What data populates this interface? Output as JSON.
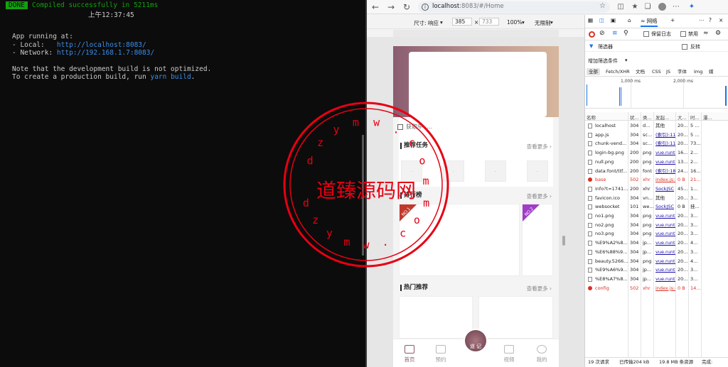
{
  "terminal": {
    "done_badge": "DONE",
    "compiled": "Compiled successfully in 5211ms",
    "time": "上午12:37:45",
    "running": "App running at:",
    "local_label": "- Local:   ",
    "local_url": "http://localhost:8083/",
    "network_label": "- Network: ",
    "network_url": "http://192.168.1.7:8083/",
    "note": "Note that the development build is not optimized.",
    "prod_prefix": "To create a production build, run ",
    "prod_cmd": "yarn build",
    "prod_suffix": "."
  },
  "browser": {
    "url_host": "localhost",
    "url_rest": ":8083/#/Home",
    "back_icon": "arrow-left-icon",
    "forward_icon": "arrow-right-icon",
    "reload_icon": "reload-icon"
  },
  "device_toolbar": {
    "dimensions_label": "尺寸: 响应",
    "width": "385",
    "height": "733",
    "zoom": "100%",
    "throttle": "无限制"
  },
  "page": {
    "notice": "获取中.....",
    "section_tasks": "推荐任务",
    "more": "查看更多",
    "task_items": [
      ".",
      ".",
      ".",
      "."
    ],
    "section_rank": "排行榜",
    "rank_badges": [
      "NO.1",
      "NO.2"
    ],
    "section_hot": "热门推荐",
    "tabs": [
      "首页",
      "预约",
      "",
      "视频",
      "我的"
    ],
    "center_tab": "道 记"
  },
  "devtools": {
    "network_tab": "网络",
    "preserve_log": "保留日志",
    "disable_cache": "禁用",
    "filter": "筛选器",
    "invert": "反转",
    "more_filters": "增加筛选条件",
    "filter_types": [
      "全部",
      "Fetch/XHR",
      "文档",
      "CSS",
      "JS",
      "字体",
      "Img",
      "媒"
    ],
    "timeline_labels": [
      "1,000 ms",
      "2,000 ms"
    ],
    "columns": [
      "名称",
      "状...",
      "类...",
      "发起...",
      "大...",
      "时...",
      "瀑..."
    ],
    "rows": [
      {
        "name": "localhost",
        "status": "304",
        "type": "d...",
        "initiator": "其他",
        "size": "20...",
        "time": "5 ...",
        "error": false
      },
      {
        "name": "app.js",
        "status": "304",
        "type": "sc...",
        "initiator": "(索引):11",
        "size": "20...",
        "time": "5 ...",
        "error": false
      },
      {
        "name": "chunk-vend...",
        "status": "304",
        "type": "sc...",
        "initiator": "(索引):11",
        "size": "20...",
        "time": "73...",
        "error": false
      },
      {
        "name": "login-bg.png",
        "status": "200",
        "type": "png",
        "initiator": "vue.runti",
        "size": "16...",
        "time": "2...",
        "error": false
      },
      {
        "name": "null.png",
        "status": "200",
        "type": "png",
        "initiator": "vue.runti",
        "size": "13...",
        "time": "2...",
        "error": false
      },
      {
        "name": "data:font/ttf...",
        "status": "200",
        "type": "font",
        "initiator": "(索引):18",
        "size": "24...",
        "time": "16...",
        "error": false
      },
      {
        "name": "base",
        "status": "502",
        "type": "xhr",
        "initiator": "index.js:4",
        "size": "0 B",
        "time": "21...",
        "error": true
      },
      {
        "name": "info?t=1741...",
        "status": "200",
        "type": "xhr",
        "initiator": "SockJSC",
        "size": "45...",
        "time": "1...",
        "error": false
      },
      {
        "name": "favicon.ico",
        "status": "304",
        "type": "vn...",
        "initiator": "其他",
        "size": "20...",
        "time": "3...",
        "error": false
      },
      {
        "name": "websocket",
        "status": "101",
        "type": "we...",
        "initiator": "SockJSC",
        "size": "0 B",
        "time": "挂...",
        "error": false
      },
      {
        "name": "no1.png",
        "status": "304",
        "type": "png",
        "initiator": "vue.runti",
        "size": "20...",
        "time": "3...",
        "error": false
      },
      {
        "name": "no2.png",
        "status": "304",
        "type": "png",
        "initiator": "vue.runti",
        "size": "20...",
        "time": "3...",
        "error": false
      },
      {
        "name": "no3.png",
        "status": "304",
        "type": "png",
        "initiator": "vue.runti",
        "size": "20...",
        "time": "3...",
        "error": false
      },
      {
        "name": "%E9%A2%8...",
        "status": "304",
        "type": "jp...",
        "initiator": "vue.runti",
        "size": "20...",
        "time": "4...",
        "error": false
      },
      {
        "name": "%E6%88%9...",
        "status": "304",
        "type": "jp...",
        "initiator": "vue.runti",
        "size": "20...",
        "time": "3...",
        "error": false
      },
      {
        "name": "beauty.5266...",
        "status": "304",
        "type": "png",
        "initiator": "vue.runti",
        "size": "20...",
        "time": "4...",
        "error": false
      },
      {
        "name": "%E9%A6%9...",
        "status": "304",
        "type": "jp...",
        "initiator": "vue.runti",
        "size": "20...",
        "time": "3...",
        "error": false
      },
      {
        "name": "%E8%A7%8...",
        "status": "304",
        "type": "jp...",
        "initiator": "vue.runti",
        "size": "20...",
        "time": "3...",
        "error": false
      },
      {
        "name": "config",
        "status": "502",
        "type": "xhr",
        "initiator": "index.js:4",
        "size": "0 B",
        "time": "14...",
        "error": true
      }
    ],
    "status_requests": "19 次请求",
    "status_transferred": "已传输204 kB",
    "status_resources": "19.8 MB 条资源",
    "status_finish": "完成:"
  },
  "watermark": {
    "text": "道臻源码网",
    "letters": [
      "d",
      "z",
      "y",
      "m",
      "w",
      ".",
      "c",
      "o",
      "m"
    ],
    "color": "#e60012"
  }
}
